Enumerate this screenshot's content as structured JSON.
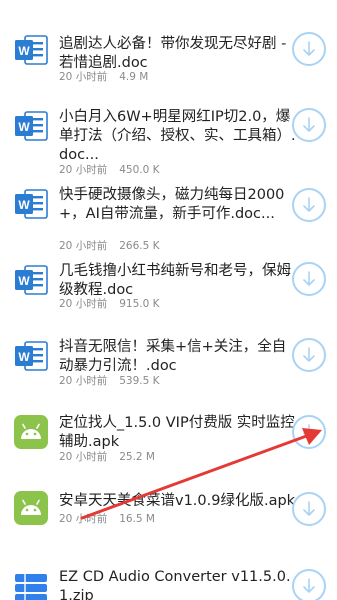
{
  "colors": {
    "word_icon": "#2b7cd3",
    "apk_icon": "#8cc34a",
    "zip_icon": "#2f80ed",
    "download_ring": "#a9d3f5",
    "annotation_arrow": "#e53935"
  },
  "files": [
    {
      "icon": "word-doc-icon",
      "name": "追剧达人必备！带你发现无尽好剧 - 若惜追剧.doc",
      "time": "20 小时前",
      "size": "4.9 M"
    },
    {
      "icon": "word-doc-icon",
      "name": "小白月入6W+明星网红IP切2.0，爆单打法（介绍、授权、实、工具箱）.doc...",
      "time": "20 小时前",
      "size": "450.0 K"
    },
    {
      "icon": "word-doc-icon",
      "name": "快手硬改摄像头，磁力纯每日2000+，AI自带流量，新手可作.doc...",
      "time": "20 小时前",
      "size": "266.5 K"
    },
    {
      "icon": "word-doc-icon",
      "name": "几毛钱撸小红书纯新号和老号，保姆级教程.doc",
      "time": "20 小时前",
      "size": "915.0 K"
    },
    {
      "icon": "word-doc-icon",
      "name": "抖音无限信！采集+信+关注，全自动暴力引流！.doc",
      "time": "20 小时前",
      "size": "539.5 K"
    },
    {
      "icon": "android-apk-icon",
      "name": "定位找人_1.5.0 VIP付费版 实时监控辅助.apk",
      "time": "20 小时前",
      "size": "25.2 M"
    },
    {
      "icon": "android-apk-icon",
      "name": "安卓天天美食菜谱v1.0.9绿化版.apk",
      "time": "20 小时前",
      "size": "16.5 M"
    },
    {
      "icon": "zip-archive-icon",
      "name": "EZ CD Audio Converter v11.5.0.1.zip",
      "time": "",
      "size": ""
    }
  ]
}
